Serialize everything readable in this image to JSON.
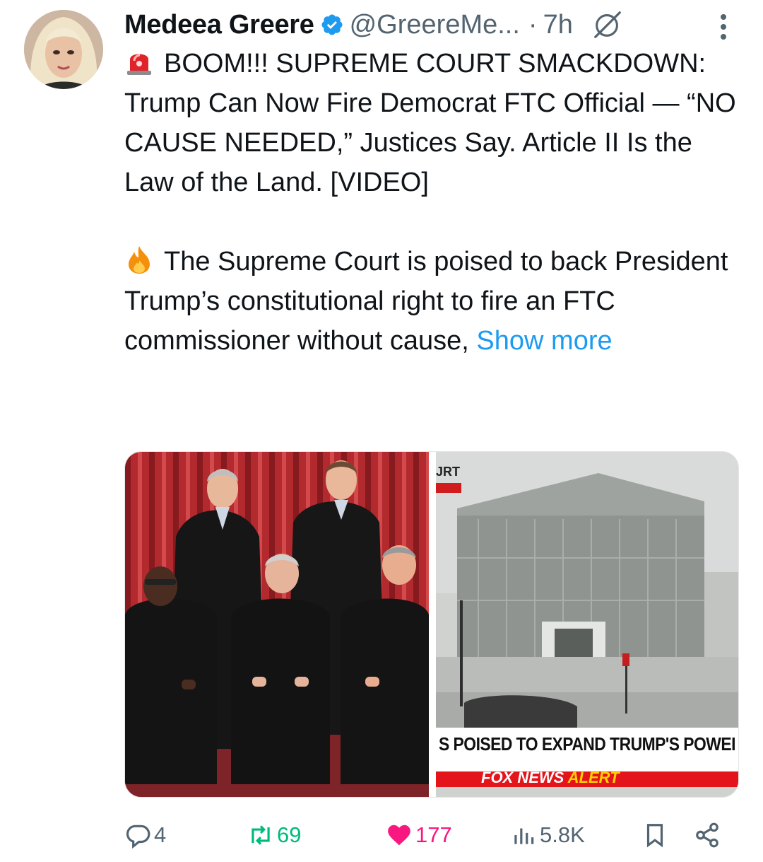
{
  "tweet": {
    "author_name": "Medeea Greere",
    "handle": "@GreereMe...",
    "separator": "·",
    "time": "7h",
    "text_line1": "BOOM!!! SUPREME COURT SMACKDOWN: Trump Can Now Fire Democrat FTC Official — “NO CAUSE NEEDED,” Justices Say. Article II Is the Law of the Land. [VIDEO]",
    "text_line2": "The Supreme Court is poised to back President Trump’s constitutional right to fire an FTC commissioner without cause,",
    "show_more": "Show more"
  },
  "media": {
    "right_banner_text": "S POISED TO EXPAND TRUMP'S POWEI",
    "alert_prefix": "FOX NEWS",
    "alert_word": "ALERT",
    "corner_tag": "JRT"
  },
  "actions": {
    "replies": "4",
    "retweets": "69",
    "likes": "177",
    "views": "5.8K"
  },
  "colors": {
    "link": "#1d9bf0",
    "retweet": "#00ba7c",
    "like": "#f91880",
    "muted": "#536471"
  }
}
